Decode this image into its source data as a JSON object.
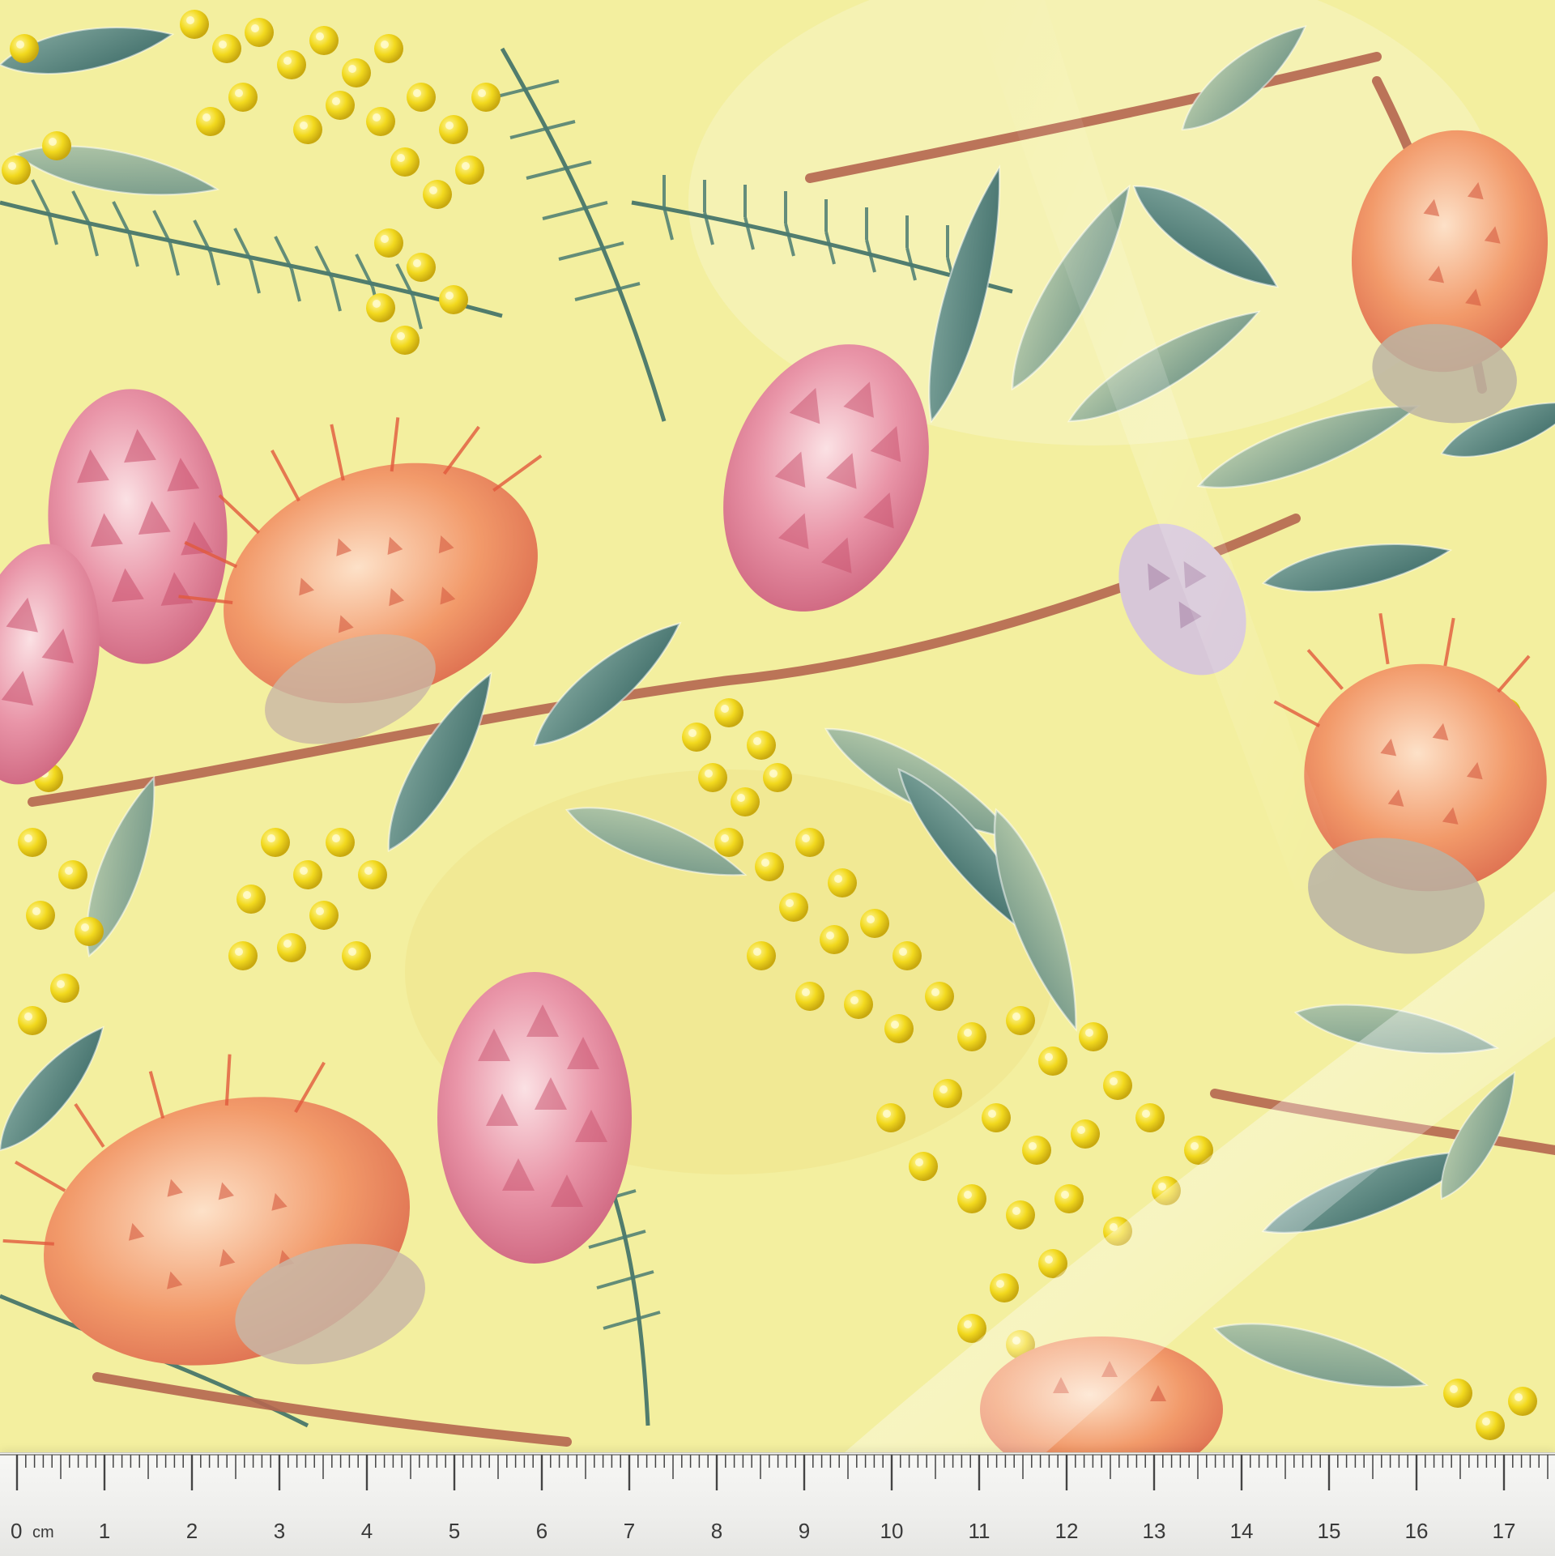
{
  "image": {
    "subject": "watercolor botanical print fabric",
    "background_color": "#f3ef9f",
    "motifs": [
      "protea-flower",
      "banksia-flower",
      "wattle-blossom",
      "eucalyptus-leaf",
      "fern-frond"
    ],
    "palette": {
      "wattle": "#f2d91e",
      "protea_pink": "#e07d95",
      "banksia_orange": "#ef8f62",
      "leaf_sage": "#8fae8a",
      "leaf_teal": "#4f7f78",
      "stem": "#b5664f"
    }
  },
  "ruler": {
    "unit": "cm",
    "labels": [
      "0",
      "1",
      "2",
      "3",
      "4",
      "5",
      "6",
      "7",
      "8",
      "9",
      "10",
      "11",
      "12",
      "13",
      "14",
      "15",
      "16",
      "17"
    ]
  }
}
